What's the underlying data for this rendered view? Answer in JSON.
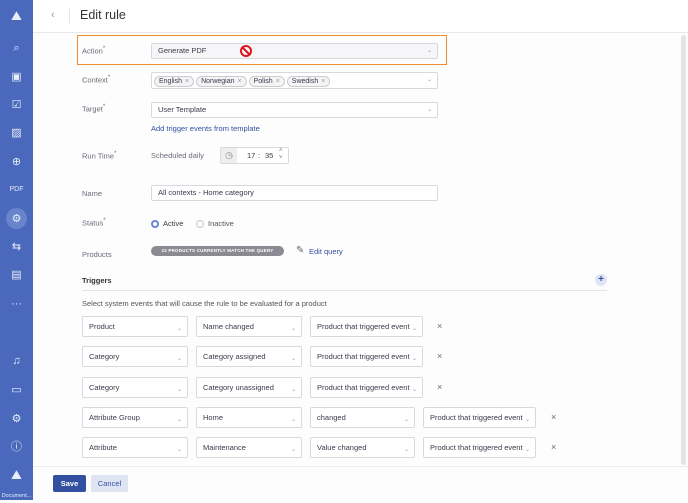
{
  "sidebar": {
    "bottom_label": "Document...",
    "icons": [
      "logo-icon",
      "search-icon",
      "box-icon",
      "task-icon",
      "image-icon",
      "globe-icon",
      "pdf-icon",
      "automation-icon",
      "transfer-icon",
      "report-icon",
      "more-icon",
      "bell-icon",
      "activity-icon",
      "settings-icon",
      "help-icon",
      "logo-icon"
    ]
  },
  "header": {
    "title": "Edit rule"
  },
  "form": {
    "action": {
      "label": "Action",
      "value": "Generate PDF"
    },
    "context": {
      "label": "Context",
      "chips": [
        "English",
        "Norwegian",
        "Polish",
        "Swedish"
      ]
    },
    "target": {
      "label": "Target",
      "value": "User Template",
      "link": "Add trigger events from template"
    },
    "run_time": {
      "label": "Run Time",
      "schedule": "Scheduled daily",
      "hour": "17",
      "minute": "35"
    },
    "name": {
      "label": "Name",
      "value": "All contexts - Home category"
    },
    "status": {
      "label": "Status",
      "options": [
        "Active",
        "Inactive"
      ],
      "selected": "Active"
    },
    "products": {
      "label": "Products",
      "badge": "22 PRODUCTS CURRENTLY MATCH THE QUERY",
      "edit_link": "Edit query"
    }
  },
  "triggers": {
    "title": "Triggers",
    "description": "Select system events that will cause the rule to be evaluated for a product",
    "rows": [
      [
        "Product",
        "Name changed",
        "Product that triggered event"
      ],
      [
        "Category",
        "Category assigned",
        "Product that triggered event"
      ],
      [
        "Category",
        "Category unassigned",
        "Product that triggered event"
      ],
      [
        "Attribute Group",
        "Home",
        "changed",
        "Product that triggered event"
      ],
      [
        "Attribute",
        "Maintenance",
        "Value changed",
        "Product that triggered event"
      ]
    ]
  },
  "footer": {
    "save": "Save",
    "cancel": "Cancel"
  },
  "colors": {
    "sidebar": "#4a69bd",
    "highlight": "#f08c2e",
    "primary": "#3350a0"
  }
}
